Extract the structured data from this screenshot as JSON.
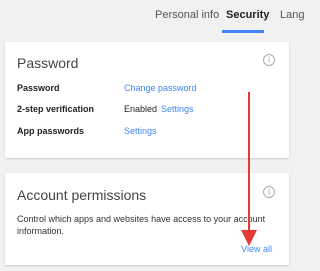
{
  "tabs": [
    {
      "label": "Personal info"
    },
    {
      "label": "Security"
    },
    {
      "label": "Lang"
    }
  ],
  "password_card": {
    "title": "Password",
    "rows": [
      {
        "label": "Password",
        "value": "",
        "link": "Change password"
      },
      {
        "label": "2-step verification",
        "value": "Enabled",
        "link": "Settings"
      },
      {
        "label": "App passwords",
        "value": "",
        "link": "Settings"
      }
    ]
  },
  "permissions_card": {
    "title": "Account permissions",
    "description": "Control which apps and websites have access to your account information.",
    "view_all": "View all"
  },
  "colors": {
    "accent": "#4285f4",
    "annotation_arrow": "#e53935"
  }
}
